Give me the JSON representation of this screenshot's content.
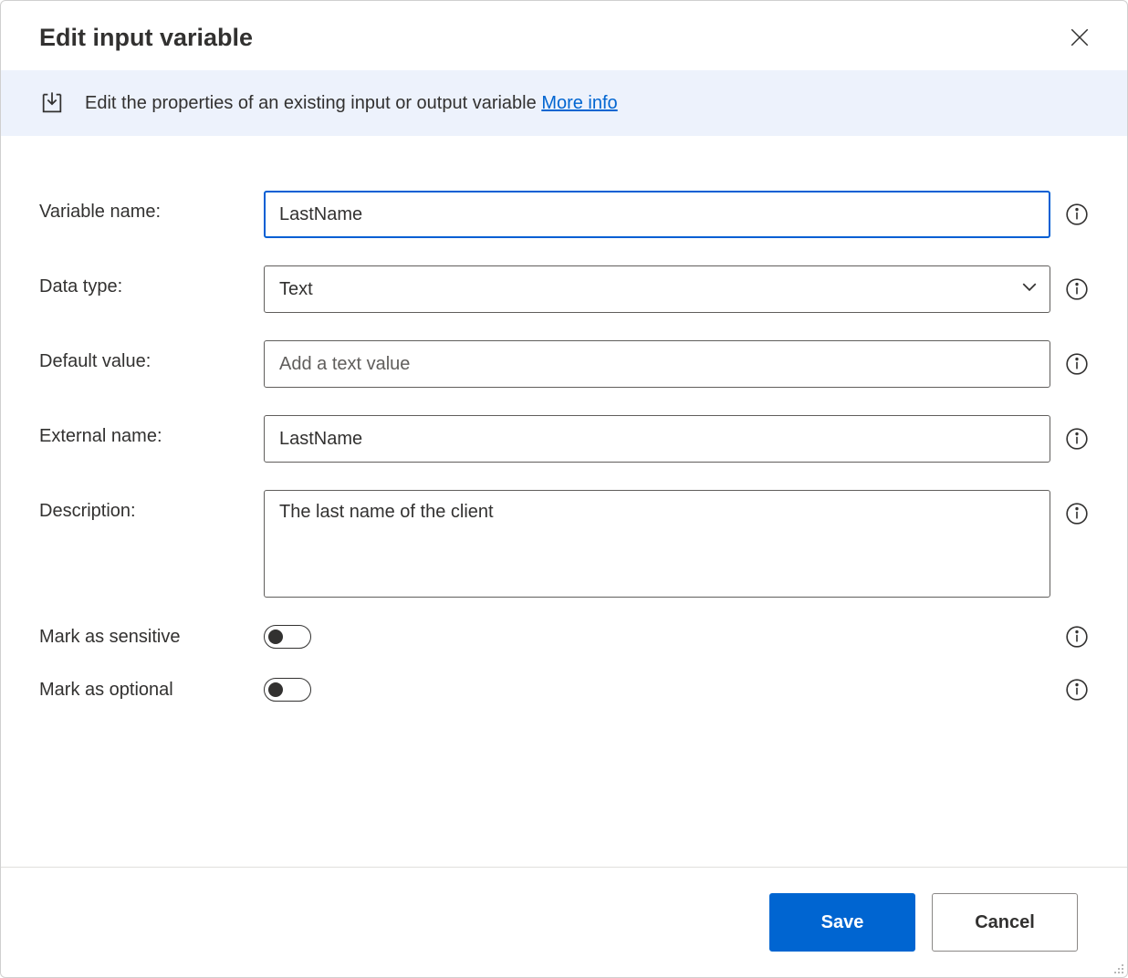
{
  "dialog": {
    "title": "Edit input variable"
  },
  "banner": {
    "text": "Edit the properties of an existing input or output variable ",
    "link": "More info"
  },
  "form": {
    "variableName": {
      "label": "Variable name:",
      "value": "LastName"
    },
    "dataType": {
      "label": "Data type:",
      "value": "Text"
    },
    "defaultValue": {
      "label": "Default value:",
      "placeholder": "Add a text value",
      "value": ""
    },
    "externalName": {
      "label": "External name:",
      "value": "LastName"
    },
    "description": {
      "label": "Description:",
      "value": "The last name of the client"
    },
    "markSensitive": {
      "label": "Mark as sensitive",
      "value": false
    },
    "markOptional": {
      "label": "Mark as optional",
      "value": false
    }
  },
  "footer": {
    "save": "Save",
    "cancel": "Cancel"
  }
}
